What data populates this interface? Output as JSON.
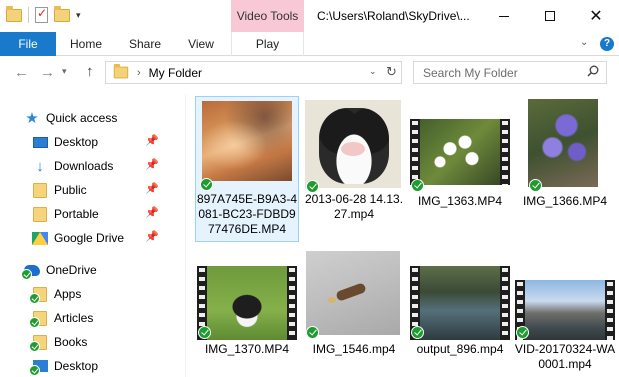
{
  "title_bar": {
    "contextual_tab": "Video Tools",
    "window_title": "C:\\Users\\Roland\\SkyDrive\\..."
  },
  "ribbon": {
    "tabs": [
      "File",
      "Home",
      "Share",
      "View",
      "Play"
    ]
  },
  "address": {
    "path": "My Folder",
    "search_placeholder": "Search My Folder"
  },
  "sidebar": {
    "items": [
      {
        "label": "Quick access",
        "icon": "star-icon"
      },
      {
        "label": "Desktop",
        "icon": "desktop-icon",
        "pinned": true
      },
      {
        "label": "Downloads",
        "icon": "download-icon",
        "pinned": true
      },
      {
        "label": "Public",
        "icon": "folder-icon",
        "pinned": true
      },
      {
        "label": "Portable",
        "icon": "folder-icon",
        "pinned": true
      },
      {
        "label": "Google Drive",
        "icon": "google-drive-icon",
        "pinned": true
      },
      {
        "label": "OneDrive",
        "icon": "onedrive-icon"
      },
      {
        "label": "Apps",
        "icon": "folder-synced-icon"
      },
      {
        "label": "Articles",
        "icon": "folder-synced-icon"
      },
      {
        "label": "Books",
        "icon": "folder-synced-icon"
      },
      {
        "label": "Desktop",
        "icon": "desktop-synced-icon"
      }
    ]
  },
  "files": [
    {
      "name": "897A745E-B9A3-4081-BC23-FDBD977476DE.MP4",
      "selected": true
    },
    {
      "name": "2013-06-28 14.13.27.mp4"
    },
    {
      "name": "IMG_1363.MP4"
    },
    {
      "name": "IMG_1366.MP4"
    },
    {
      "name": "IMG_1370.MP4"
    },
    {
      "name": "IMG_1546.mp4"
    },
    {
      "name": "output_896.mp4"
    },
    {
      "name": "VID-20170324-WA0001.mp4"
    }
  ],
  "colors": {
    "accent": "#1979ca",
    "contextual_tab": "#f9c8d6",
    "sync_ok": "#1e9c30",
    "selection": "#e5f3ff"
  }
}
